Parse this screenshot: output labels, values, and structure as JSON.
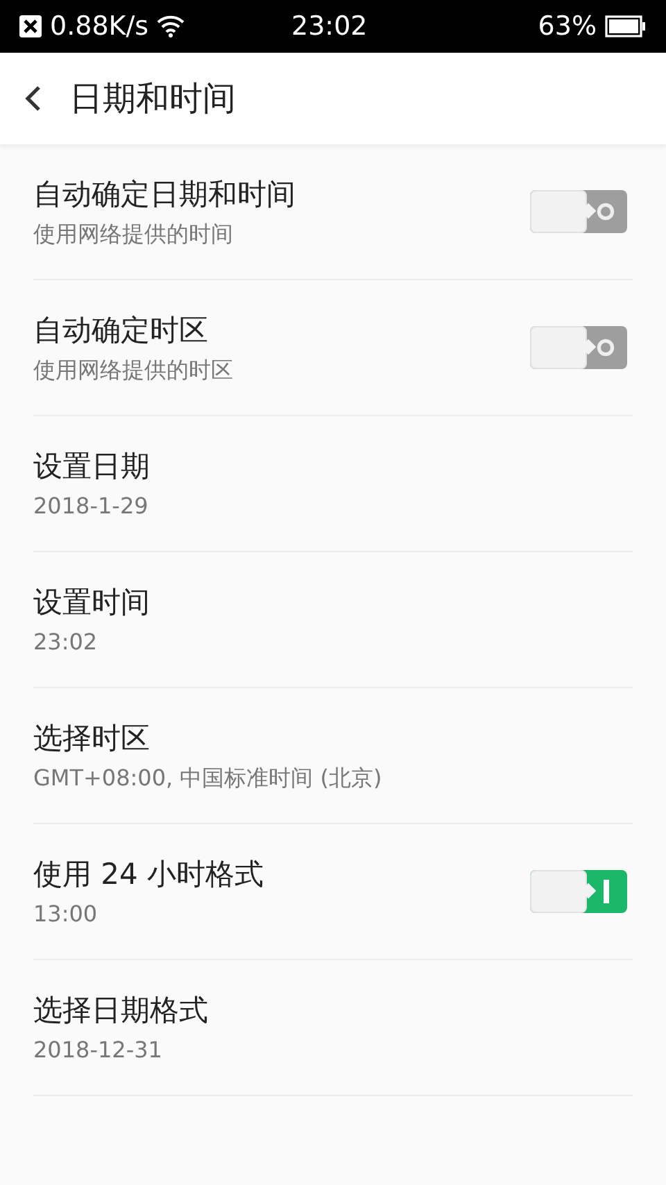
{
  "status_bar": {
    "speed": "0.88K/s",
    "time": "23:02",
    "battery": "63%"
  },
  "header": {
    "title": "日期和时间"
  },
  "rows": [
    {
      "kind": "switch",
      "title": "自动确定日期和时间",
      "subtitle": "使用网络提供的时间",
      "on": false
    },
    {
      "kind": "switch",
      "title": "自动确定时区",
      "subtitle": "使用网络提供的时区",
      "on": false
    },
    {
      "kind": "value",
      "title": "设置日期",
      "subtitle": "2018-1-29"
    },
    {
      "kind": "value",
      "title": "设置时间",
      "subtitle": "23:02"
    },
    {
      "kind": "value",
      "title": "选择时区",
      "subtitle": "GMT+08:00, 中国标准时间 (北京)"
    },
    {
      "kind": "switch",
      "title": "使用 24 小时格式",
      "subtitle": "13:00",
      "on": true
    },
    {
      "kind": "value",
      "title": "选择日期格式",
      "subtitle": "2018-12-31"
    }
  ]
}
